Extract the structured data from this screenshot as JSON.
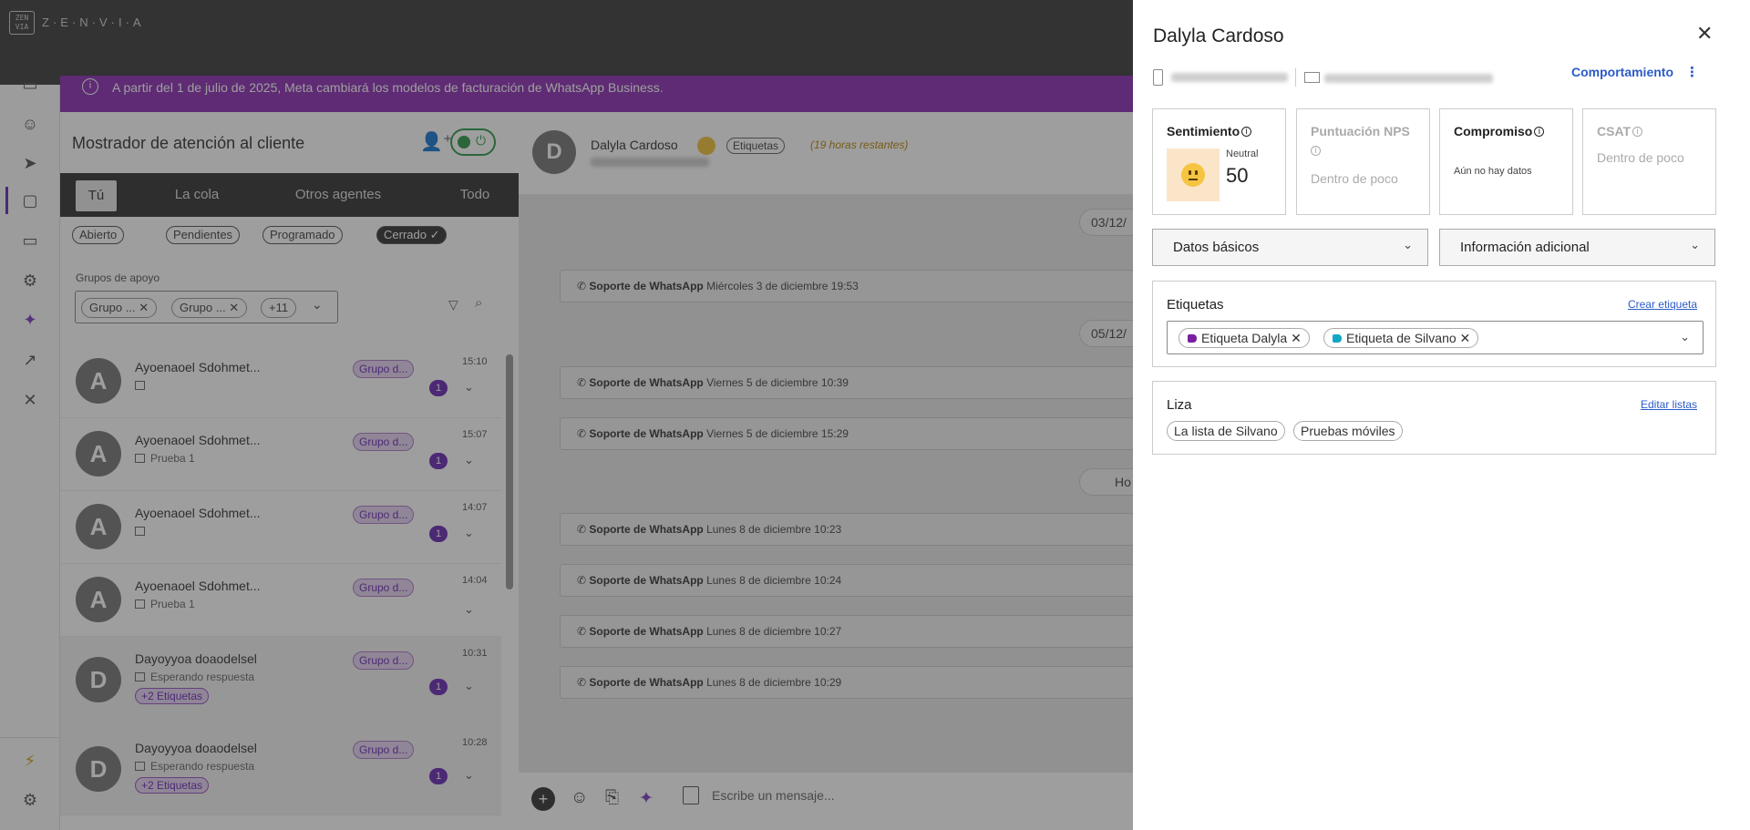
{
  "app": {
    "logo_mark": "ZEN VIA",
    "logo_text": "Z·E·N·V·I·A"
  },
  "banner": {
    "text": "A partir del 1 de julio de 2025, Meta cambiará los modelos de facturación de WhatsApp Business."
  },
  "panel": {
    "title": "Mostrador de atención al cliente",
    "tabs": [
      "Tú",
      "La cola",
      "Otros agentes",
      "Todo"
    ],
    "filters": [
      "Abierto",
      "Pendientes",
      "Programado",
      "Cerrado ✓"
    ],
    "groups_label": "Grupos de apoyo",
    "group_chips": [
      "Grupo ... ✕",
      "Grupo ... ✕",
      "+11"
    ]
  },
  "conversations": [
    {
      "initial": "A",
      "name": "Ayoenaoel Sdohmet...",
      "sub": "",
      "group": "Grupo d...",
      "time": "15:10",
      "badge": "1",
      "tag": ""
    },
    {
      "initial": "A",
      "name": "Ayoenaoel Sdohmet...",
      "sub": "Prueba 1",
      "group": "Grupo d...",
      "time": "15:07",
      "badge": "1",
      "tag": ""
    },
    {
      "initial": "A",
      "name": "Ayoenaoel Sdohmet...",
      "sub": "",
      "group": "Grupo d...",
      "time": "14:07",
      "badge": "1",
      "tag": ""
    },
    {
      "initial": "A",
      "name": "Ayoenaoel Sdohmet...",
      "sub": "Prueba 1",
      "group": "Grupo d...",
      "time": "14:04",
      "badge": "",
      "tag": ""
    },
    {
      "initial": "D",
      "name": "Dayoyyoa doaodelsel",
      "sub": "Esperando respuesta",
      "group": "Grupo d...",
      "time": "10:31",
      "badge": "1",
      "tag": "+2 Etiquetas"
    },
    {
      "initial": "D",
      "name": "Dayoyyoa doaodelsel",
      "sub": "Esperando respuesta",
      "group": "Grupo d...",
      "time": "10:28",
      "badge": "1",
      "tag": "+2 Etiquetas"
    }
  ],
  "chat": {
    "initial": "D",
    "name": "Dalyla Cardoso",
    "tag": "Etiquetas",
    "time_left": "(19 horas restantes)",
    "dates": [
      "03/12/",
      "05/12/",
      "Ho"
    ],
    "messages": [
      {
        "sender": "Soporte  de WhatsApp",
        "when": "Miércoles 3 de diciembre 19:53"
      },
      {
        "sender": "Soporte  de WhatsApp",
        "when": "Viernes 5 de diciembre 10:39"
      },
      {
        "sender": "Soporte  de WhatsApp",
        "when": "Viernes 5 de diciembre 15:29"
      },
      {
        "sender": "Soporte  de WhatsApp",
        "when": "Lunes 8 de diciembre 10:23"
      },
      {
        "sender": "Soporte  de WhatsApp",
        "when": "Lunes 8 de diciembre 10:24"
      },
      {
        "sender": "Soporte  de WhatsApp",
        "when": "Lunes 8 de diciembre 10:27"
      },
      {
        "sender": "Soporte  de WhatsApp",
        "when": "Lunes 8 de diciembre 10:29"
      }
    ],
    "composer_placeholder": "Escribe un mensaje..."
  },
  "drawer": {
    "name": "Dalyla Cardoso",
    "behavior_link": "Comportamiento",
    "metrics": [
      {
        "title": "Sentimiento",
        "label": "Neutral",
        "value": "50"
      },
      {
        "title": "Puntuación NPS",
        "value": "Dentro de poco"
      },
      {
        "title": "Compromiso",
        "value": "Aún no hay datos"
      },
      {
        "title": "CSAT",
        "value": "Dentro de poco"
      }
    ],
    "dropdowns": [
      "Datos básicos",
      "Información adicional"
    ],
    "tags_section": {
      "title": "Etiquetas",
      "link": "Crear etiqueta",
      "tags": [
        {
          "label": "Etiqueta Dalyla",
          "color": "#7a1fa2"
        },
        {
          "label": "Etiqueta de Silvano",
          "color": "#12a7c7"
        }
      ]
    },
    "lists_section": {
      "title": "Liza",
      "link": "Editar listas",
      "items": [
        "La lista de Silvano",
        "Pruebas móviles"
      ]
    }
  },
  "colors": {
    "accent": "#6b2bb5",
    "banner": "#8a2fb2",
    "link": "#2b5cc7",
    "online": "#2e9a4a"
  }
}
